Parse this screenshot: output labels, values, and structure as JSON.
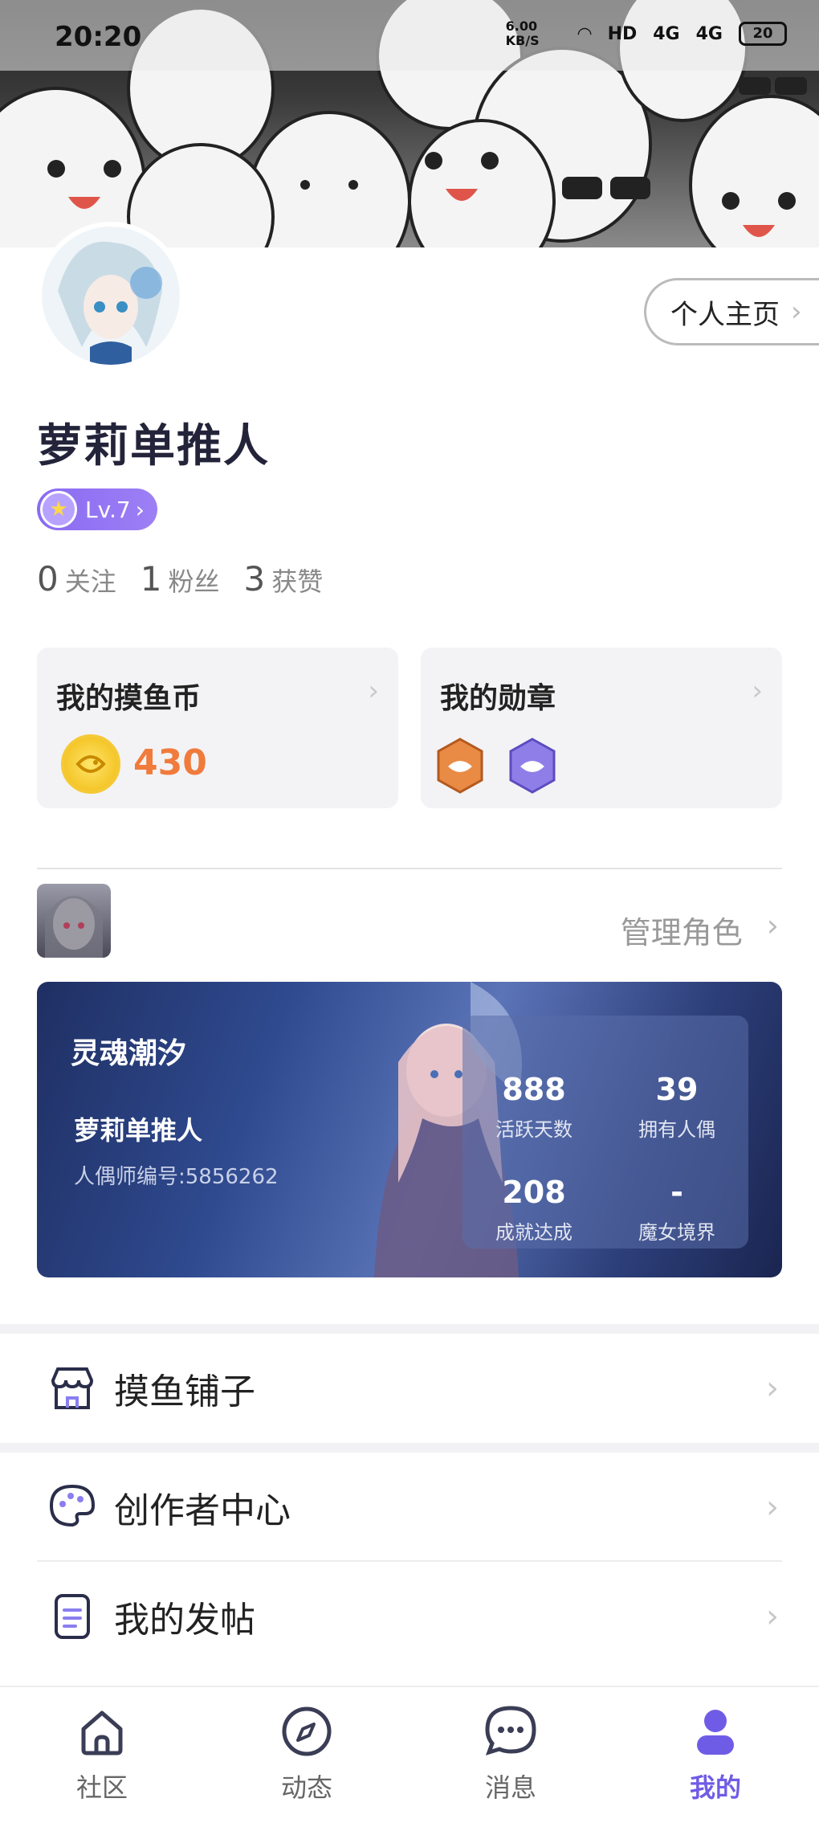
{
  "status_bar": {
    "time": "20:20",
    "net_speed": "6.00 KB/S",
    "signal1": "4G",
    "signal2": "4G",
    "battery": "20"
  },
  "profile": {
    "home_button": "个人主页",
    "username": "萝莉单推人",
    "level": "Lv.7",
    "stats": [
      {
        "num": "0",
        "label": "关注"
      },
      {
        "num": "1",
        "label": "粉丝"
      },
      {
        "num": "3",
        "label": "获赞"
      }
    ]
  },
  "cards": {
    "coins_title": "我的摸鱼币",
    "coins_value": "430",
    "medals_title": "我的勋章"
  },
  "role": {
    "manage_label": "管理角色",
    "server": "灵魂潮汐",
    "name": "萝莉单推人",
    "id_label": "人偶师编号:5856262",
    "stats": [
      {
        "value": "888",
        "label": "活跃天数"
      },
      {
        "value": "39",
        "label": "拥有人偶"
      },
      {
        "value": "208",
        "label": "成就达成"
      },
      {
        "value": "-",
        "label": "魔女境界"
      }
    ]
  },
  "menu": {
    "shop": "摸鱼铺子",
    "creator": "创作者中心",
    "posts": "我的发帖"
  },
  "tabs": [
    {
      "label": "社区",
      "icon": "home-icon"
    },
    {
      "label": "动态",
      "icon": "compass-icon"
    },
    {
      "label": "消息",
      "icon": "chat-icon"
    },
    {
      "label": "我的",
      "icon": "profile-icon"
    }
  ],
  "colors": {
    "accent": "#6f5ce6",
    "coin_value": "#f07b3c",
    "level_badge": "#8a6bf2"
  }
}
